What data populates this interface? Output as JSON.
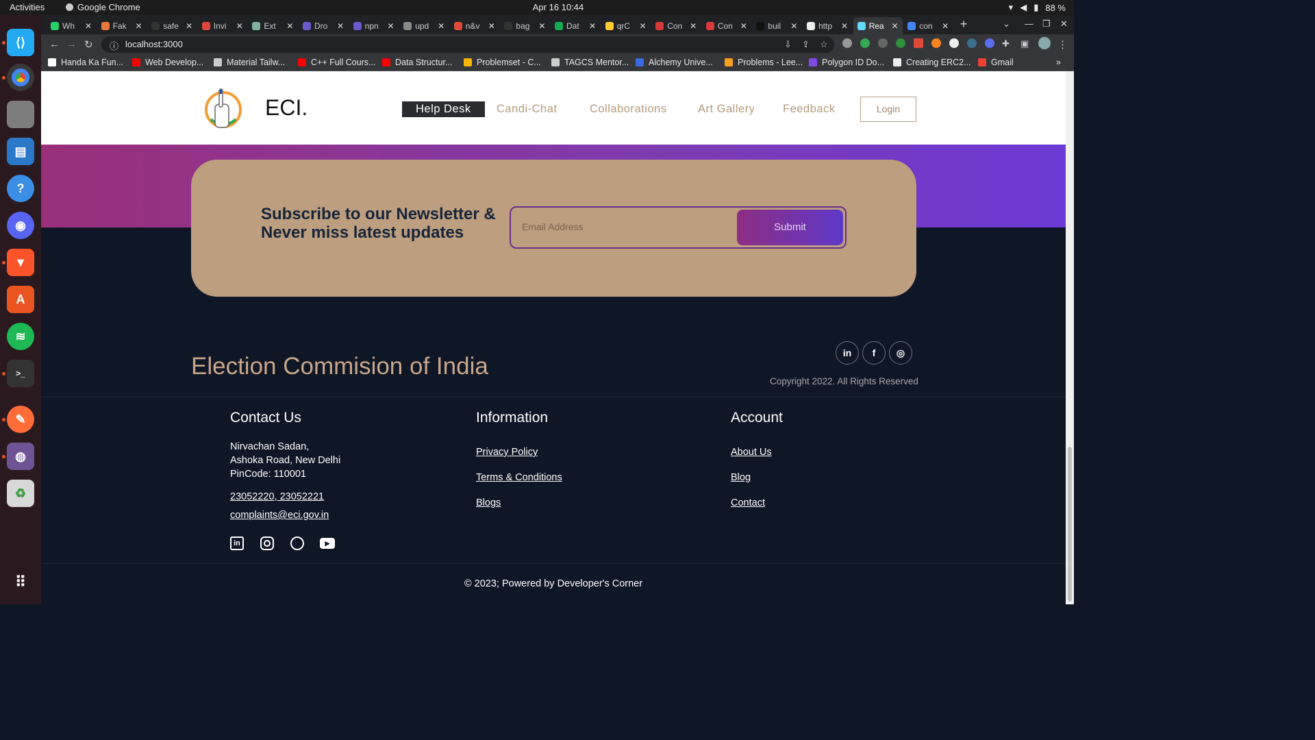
{
  "system": {
    "activities": "Activities",
    "app": "Google Chrome",
    "clock": "Apr 16  10:44",
    "battery": "88 %"
  },
  "browser": {
    "tabs": [
      {
        "label": "Wh",
        "color": "#25d366"
      },
      {
        "label": "Fak",
        "color": "#e8773a"
      },
      {
        "label": "safe",
        "color": "#333"
      },
      {
        "label": "Invi",
        "color": "#e0453a"
      },
      {
        "label": "Ext",
        "color": "#7fb5a0"
      },
      {
        "label": "Dro",
        "color": "#6a5acd"
      },
      {
        "label": "npn",
        "color": "#6a5acd"
      },
      {
        "label": "upd",
        "color": "#888"
      },
      {
        "label": "n&v",
        "color": "#e04a3a"
      },
      {
        "label": "bag",
        "color": "#333"
      },
      {
        "label": "Dat",
        "color": "#13aa52"
      },
      {
        "label": "qrC",
        "color": "#ffcc33"
      },
      {
        "label": "Con",
        "color": "#d93a3a"
      },
      {
        "label": "Con",
        "color": "#d93a3a"
      },
      {
        "label": "buil",
        "color": "#111"
      },
      {
        "label": "http",
        "color": "#eee"
      },
      {
        "label": "Rea",
        "color": "#61dafb"
      },
      {
        "label": "con",
        "color": "#4285f4"
      }
    ],
    "url": "localhost:3000",
    "bookmarks": [
      {
        "label": "Handa Ka Fun...",
        "color": "#fff"
      },
      {
        "label": "Web Develop...",
        "color": "#ff0000"
      },
      {
        "label": "Material Tailw...",
        "color": "#ccc"
      },
      {
        "label": "C++ Full Cours...",
        "color": "#ff0000"
      },
      {
        "label": "Data Structur...",
        "color": "#ff0000"
      },
      {
        "label": "Problemset - C...",
        "color": "#f4b400"
      },
      {
        "label": "TAGCS Mentor...",
        "color": "#ccc"
      },
      {
        "label": "Alchemy Unive...",
        "color": "#3a6ae0"
      },
      {
        "label": "Problems - Lee...",
        "color": "#f89f1b"
      },
      {
        "label": "Polygon ID Do...",
        "color": "#8247e5"
      },
      {
        "label": "Creating ERC2...",
        "color": "#eee"
      },
      {
        "label": "Gmail",
        "color": "#ea4335"
      }
    ],
    "bookmarks_more": "»"
  },
  "site": {
    "brand": "ECI.",
    "nav": [
      "Help Desk",
      "Candi-Chat",
      "Collaborations",
      "Art Gallery",
      "Feedback"
    ],
    "login": "Login",
    "newsletter": {
      "title": "Subscribe to our Newsletter & Never miss latest updates",
      "placeholder": "Email Address",
      "submit": "Submit"
    },
    "footer_title": "Election Commision of India",
    "social": [
      "in",
      "f",
      "◎"
    ],
    "copyright": "Copyright 2022. All Rights Reserved",
    "contact": {
      "heading": "Contact Us",
      "address1": "Nirvachan Sadan,",
      "address2": "Ashoka Road, New Delhi",
      "pincode": "PinCode: 110001",
      "phone": "23052220, 23052221",
      "email": "complaints@eci.gov.in"
    },
    "information": {
      "heading": "Information",
      "links": [
        "Privacy Policy",
        "Terms & Conditions",
        "Blogs"
      ]
    },
    "account": {
      "heading": "Account",
      "links": [
        "About Us",
        "Blog",
        "Contact"
      ]
    },
    "powered": "© 2023; Powered by Developer's Corner"
  }
}
